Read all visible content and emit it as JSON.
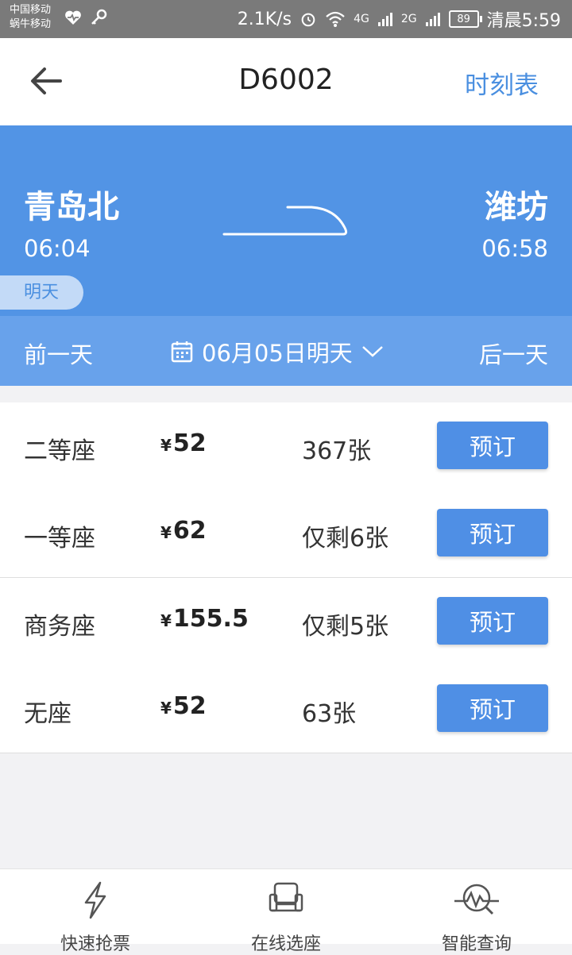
{
  "status_bar": {
    "carrier1": "中国移动",
    "carrier2": "蜗牛移动",
    "speed": "2.1K/s",
    "net1": "4G",
    "net2": "2G",
    "battery": "89",
    "time": "清晨5:59"
  },
  "nav": {
    "title": "D6002",
    "timetable": "时刻表"
  },
  "journey": {
    "from_station": "青岛北",
    "from_time": "06:04",
    "to_station": "潍坊",
    "to_time": "06:58",
    "day_label": "明天"
  },
  "date_bar": {
    "prev": "前一天",
    "date": "06月05日明天",
    "next": "后一天"
  },
  "seats": [
    {
      "type": "二等座",
      "currency": "¥",
      "price": "52",
      "count": "367张",
      "action": "预订"
    },
    {
      "type": "一等座",
      "currency": "¥",
      "price": "62",
      "count": "仅剩6张",
      "action": "预订"
    },
    {
      "type": "商务座",
      "currency": "¥",
      "price": "155.5",
      "count": "仅剩5张",
      "action": "预订"
    },
    {
      "type": "无座",
      "currency": "¥",
      "price": "52",
      "count": "63张",
      "action": "预订"
    }
  ],
  "tabs": [
    {
      "label": "快速抢票",
      "icon": "lightning-icon"
    },
    {
      "label": "在线选座",
      "icon": "seat-icon"
    },
    {
      "label": "智能查询",
      "icon": "smart-search-icon"
    }
  ],
  "colors": {
    "primary_blue": "#5294e5",
    "date_bar_blue": "#68a2eb",
    "button_blue": "#4f8fe5",
    "link_blue": "#4a8fe0"
  }
}
